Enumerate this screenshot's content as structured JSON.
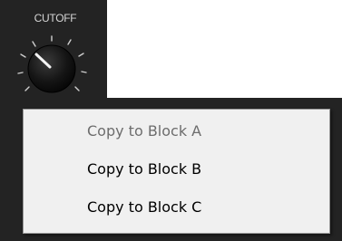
{
  "panel": {
    "knob_label": "CUTOFF"
  },
  "context_menu": {
    "items": [
      {
        "label": "Copy to Block A",
        "enabled": false
      },
      {
        "label": "Copy to Block B",
        "enabled": true
      },
      {
        "label": "Copy to Block C",
        "enabled": true
      }
    ]
  },
  "colors": {
    "panel_background": "#232323",
    "menu_background": "#f0f0f0",
    "menu_border": "#979797",
    "disabled_text": "#6d6d6d",
    "enabled_text": "#000000"
  }
}
